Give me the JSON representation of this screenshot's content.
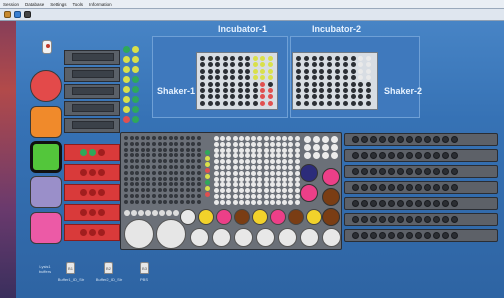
{
  "menu": [
    "Session",
    "Database",
    "Settings",
    "Tools",
    "Information"
  ],
  "incubators": [
    {
      "title": "Incubator-1"
    },
    {
      "title": "Incubator-2"
    }
  ],
  "shakers": [
    {
      "title": "Shaker-1"
    },
    {
      "title": "Shaker-2"
    }
  ],
  "bottles": [
    {
      "cap": "B1",
      "label": "Buffer1_ID_Str"
    },
    {
      "cap": "B2",
      "label": "Buffer2_ID_Str"
    },
    {
      "cap": "B3",
      "label": "PBS"
    }
  ],
  "left_label": "Lysis1\nbuffers",
  "colors": {
    "accent_red": "#e34a4a",
    "accent_orange": "#f08a2b",
    "accent_green": "#53c63b",
    "accent_lavender": "#9a8fc9",
    "accent_pink": "#ec5aa6"
  }
}
